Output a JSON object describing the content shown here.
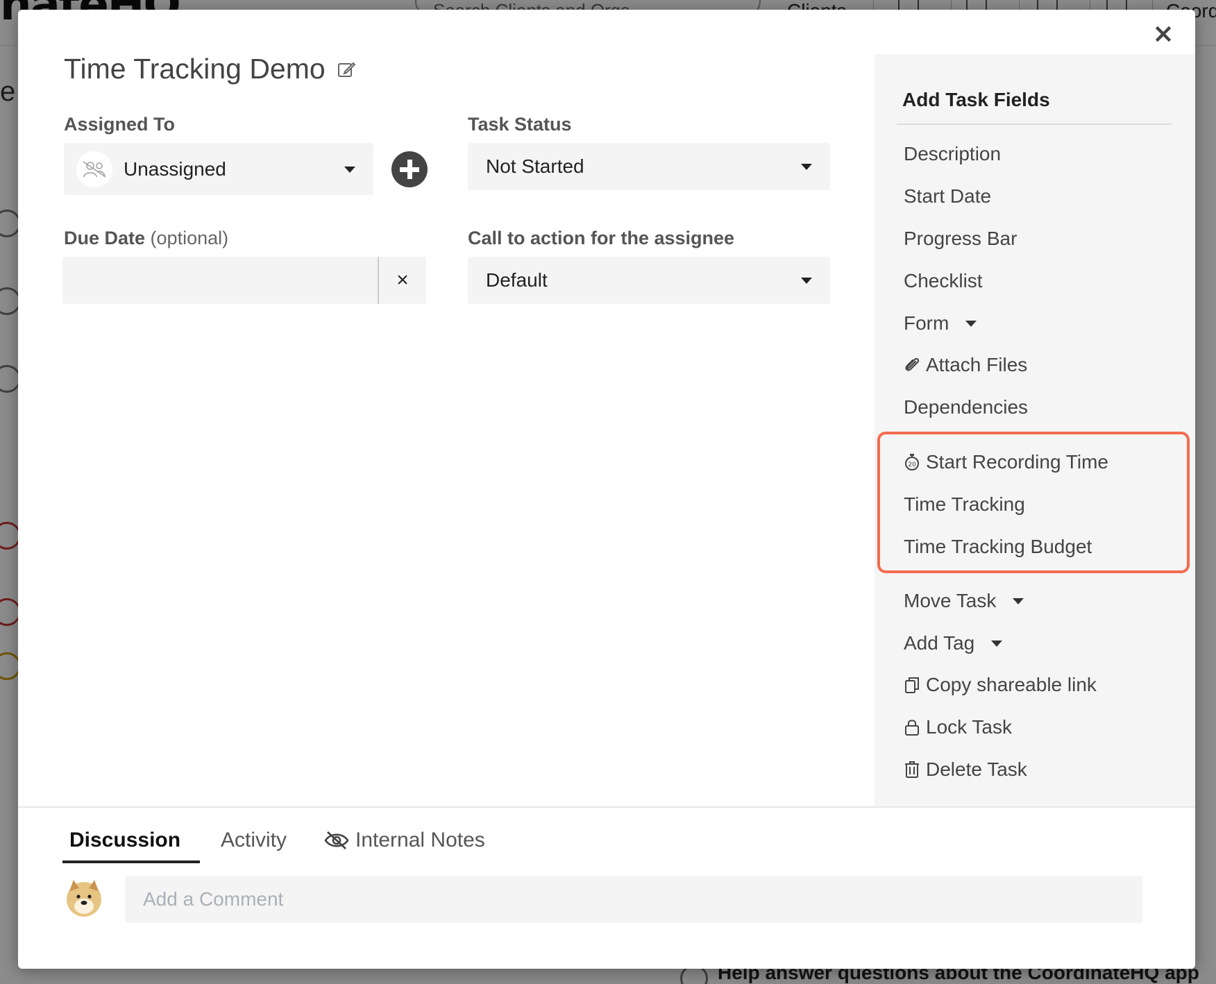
{
  "background": {
    "logo_text": "nateHQ",
    "search_placeholder": "Search Clients and Orgs",
    "nav_clients": "Clients",
    "nav_coord": "Coord",
    "left_letter": "e",
    "help_text": "Help answer questions about the CoordinateHQ app"
  },
  "modal": {
    "close_label": "×",
    "title": "Time Tracking Demo",
    "assigned_to": {
      "label": "Assigned To",
      "value": "Unassigned"
    },
    "task_status": {
      "label": "Task Status",
      "value": "Not Started"
    },
    "due_date": {
      "label": "Due Date",
      "optional": "(optional)",
      "value": "",
      "clear_label": "×"
    },
    "cta": {
      "label": "Call to action for the assignee",
      "value": "Default"
    }
  },
  "sidebar": {
    "title": "Add Task Fields",
    "items": [
      {
        "label": "Description",
        "icon": null,
        "caret": false
      },
      {
        "label": "Start Date",
        "icon": null,
        "caret": false
      },
      {
        "label": "Progress Bar",
        "icon": null,
        "caret": false
      },
      {
        "label": "Checklist",
        "icon": null,
        "caret": false
      },
      {
        "label": "Form",
        "icon": null,
        "caret": true
      },
      {
        "label": "Attach Files",
        "icon": "paperclip-icon",
        "caret": false
      },
      {
        "label": "Dependencies",
        "icon": null,
        "caret": false
      },
      {
        "label": "Start Recording Time",
        "icon": "stopwatch-icon",
        "caret": false
      },
      {
        "label": "Time Tracking",
        "icon": null,
        "caret": false
      },
      {
        "label": "Time Tracking Budget",
        "icon": null,
        "caret": false
      },
      {
        "label": "Move Task",
        "icon": null,
        "caret": true
      },
      {
        "label": "Add Tag",
        "icon": null,
        "caret": true
      },
      {
        "label": "Copy shareable link",
        "icon": "copy-icon",
        "caret": false
      },
      {
        "label": "Lock Task",
        "icon": "lock-icon",
        "caret": false
      },
      {
        "label": "Delete Task",
        "icon": "trash-icon",
        "caret": false
      }
    ],
    "highlight_color": "#f26c4f"
  },
  "tabs": [
    {
      "label": "Discussion",
      "active": true
    },
    {
      "label": "Activity",
      "active": false
    },
    {
      "label": "Internal Notes",
      "active": false,
      "icon": "eye-slash-icon"
    }
  ],
  "comment": {
    "placeholder": "Add a Comment",
    "value": ""
  }
}
